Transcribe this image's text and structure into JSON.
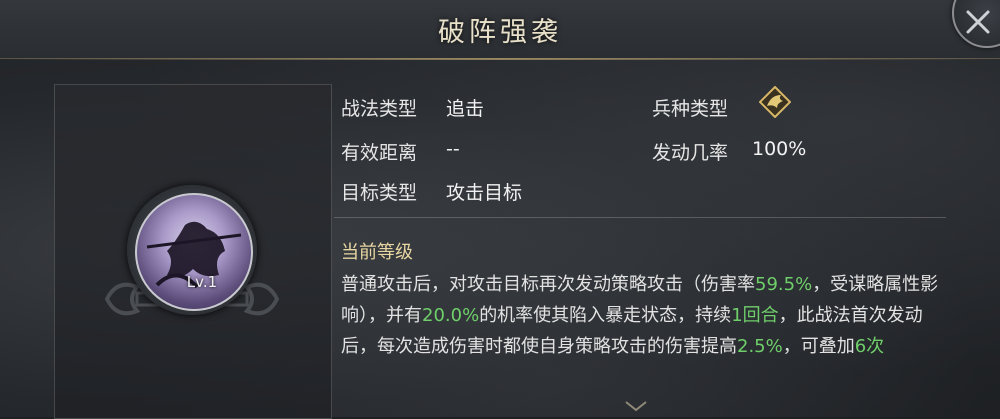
{
  "header": {
    "title": "破阵强袭"
  },
  "skill": {
    "level": "Lv.1"
  },
  "info": {
    "tactic_type_label": "战法类型",
    "tactic_type_value": "追击",
    "range_label": "有效距离",
    "range_value": "--",
    "target_label": "目标类型",
    "target_value": "攻击目标",
    "troop_label": "兵种类型",
    "trigger_label": "发动几率",
    "trigger_value": "100%"
  },
  "section": {
    "title": "当前等级"
  },
  "description": {
    "p1": "普通攻击后，对攻击目标再次发动策略攻击（伤害率",
    "v1": "59.5%",
    "p2": "，受谋略属性影响），并有",
    "v2": "20.0%",
    "p3": "的机率使其陷入暴走状态，持续",
    "v3": "1回合",
    "p4": "，此战法首次发动后，每次造成伤害时都使自身策略攻击的伤害提高",
    "v4": "2.5%",
    "p5": "，可叠加",
    "v5": "6次"
  },
  "colors": {
    "highlight": "#6fcf6a",
    "section_title": "#e8d7a2"
  },
  "icons": [
    "close-icon",
    "troop-type-icon",
    "chevron-down-icon"
  ]
}
